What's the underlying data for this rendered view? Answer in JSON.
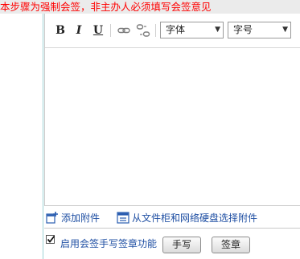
{
  "notice": {
    "text": "本步骤为强制会签，非主办人必须填写会签意见",
    "color": "#ff0000"
  },
  "toolbar": {
    "bold_label": "B",
    "italic_label": "I",
    "underline_label": "U",
    "icons": [
      "link-icon",
      "unlink-icon"
    ],
    "font_select": {
      "value": "字体"
    },
    "size_select": {
      "value": "字号"
    }
  },
  "attachments": {
    "add_label": "添加附件",
    "from_disk_label": "从文件柜和网络硬盘选择附件"
  },
  "sign": {
    "enable_label": "启用会签手写签章功能",
    "checked": true,
    "handwrite_button": "手写",
    "seal_button": "签章"
  },
  "colors": {
    "link_text": "#1f4fa3",
    "frame_accent": "#9ed3d6"
  }
}
